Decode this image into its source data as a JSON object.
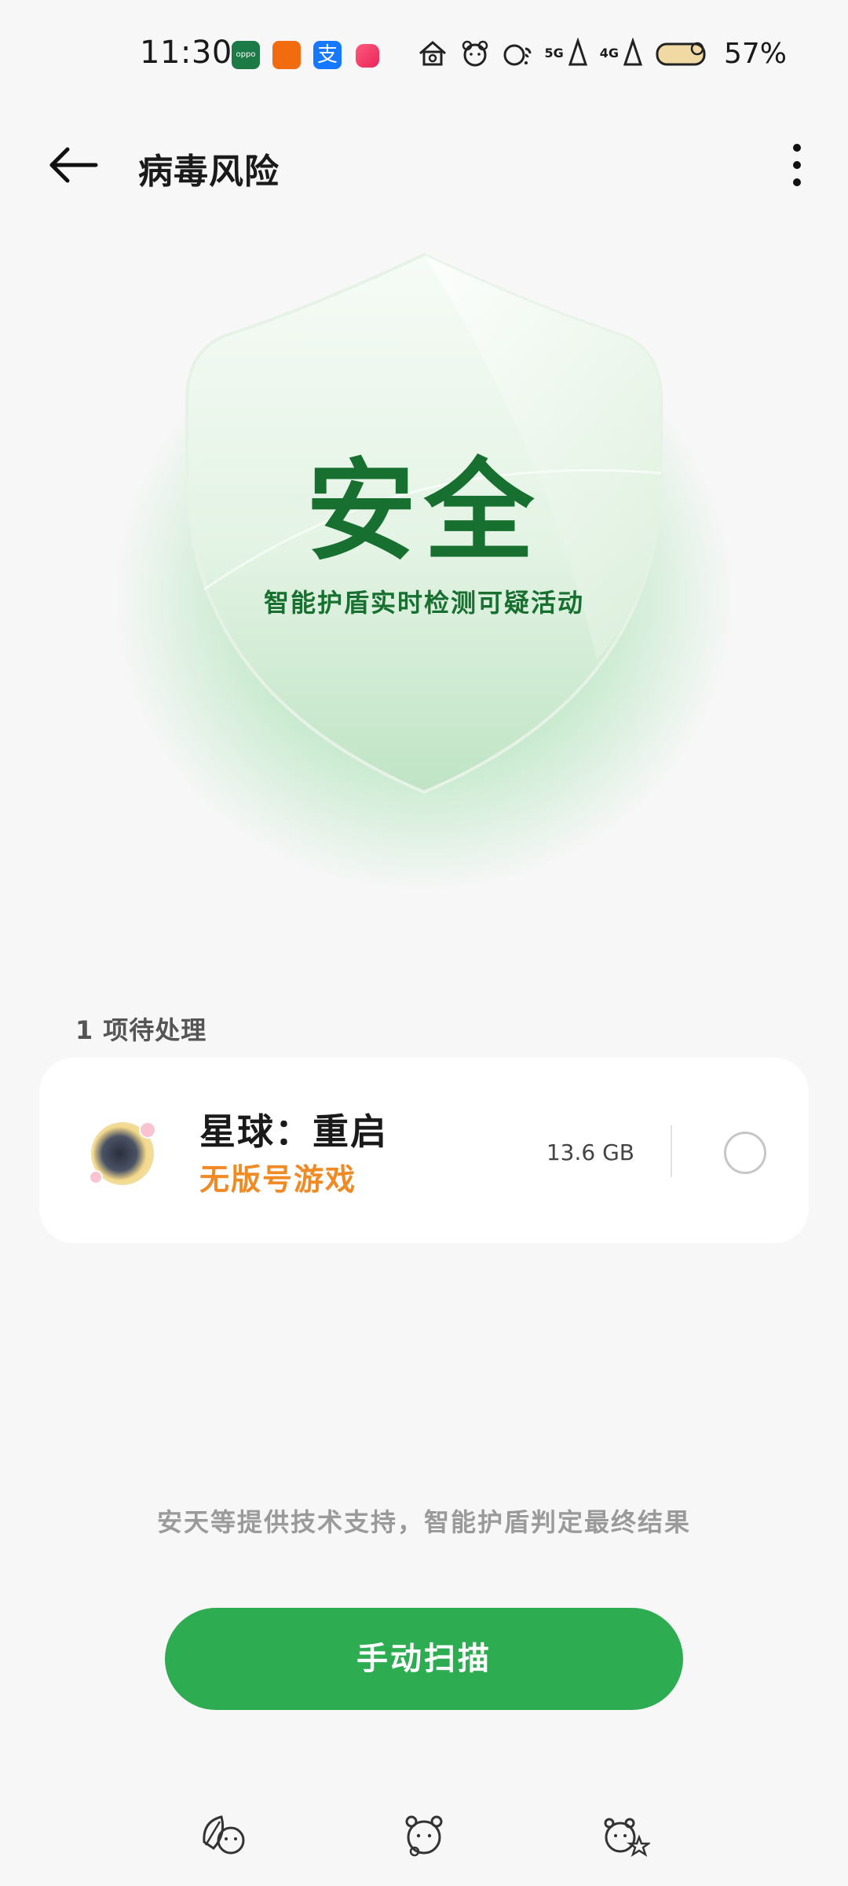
{
  "status_bar": {
    "time": "11:30",
    "oppo_badge": "oppo",
    "alipay_glyph": "支",
    "signal_5g": "5G",
    "signal_4g": "4G",
    "battery_percent": "57%",
    "icons": [
      "oppo-app-icon",
      "taobao-app-icon",
      "alipay-app-icon",
      "xiaohongshu-app-icon",
      "home-icon",
      "bear-icon",
      "wifi-icon",
      "signal-5g-icon",
      "signal-4g-icon",
      "battery-icon"
    ]
  },
  "app_bar": {
    "title": "病毒风险",
    "back_icon": "arrow-left-icon",
    "more_icon": "more-vertical-icon"
  },
  "shield": {
    "status": "安全",
    "subtitle": "智能护盾实时检测可疑活动",
    "color": "#17702f"
  },
  "pending": {
    "count": "1",
    "label": "项待处理",
    "items": [
      {
        "name": "星球：重启",
        "warning": "无版号游戏",
        "size": "13.6 GB",
        "warning_color": "#f08a25"
      }
    ]
  },
  "footnote": "安天等提供技术支持，智能护盾判定最终结果",
  "scan_button": {
    "label": "手动扫描",
    "color": "#2eac52"
  },
  "nav_bar": {
    "icons": [
      "leaf-bear-icon",
      "bear-home-icon",
      "bear-star-icon"
    ]
  }
}
